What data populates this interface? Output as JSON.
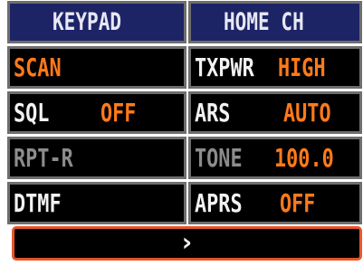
{
  "header": {
    "left": "KEYPAD",
    "right": "HOME CH"
  },
  "rows": [
    {
      "left": {
        "label": "SCAN",
        "value": ""
      },
      "right": {
        "label": "TXPWR",
        "value": "HIGH"
      }
    },
    {
      "left": {
        "label": "SQL",
        "value": "OFF"
      },
      "right": {
        "label": "ARS",
        "value": "AUTO"
      }
    },
    {
      "left": {
        "label": "RPT-R",
        "value": ""
      },
      "right": {
        "label": "TONE",
        "value": "100.0"
      }
    },
    {
      "left": {
        "label": "DTMF",
        "value": ""
      },
      "right": {
        "label": "APRS",
        "value": "OFF"
      }
    }
  ],
  "footer": {
    "next_glyph": "›"
  },
  "icons": {
    "next": "chevron-right-icon"
  },
  "colors": {
    "header_bg": "#1d2466",
    "cell_bg": "#000000",
    "cell_border": "#6e6e6e",
    "accent_orange": "#ff7a1a",
    "disabled_gray": "#8c8c8c",
    "footer_border": "#e8552a"
  }
}
